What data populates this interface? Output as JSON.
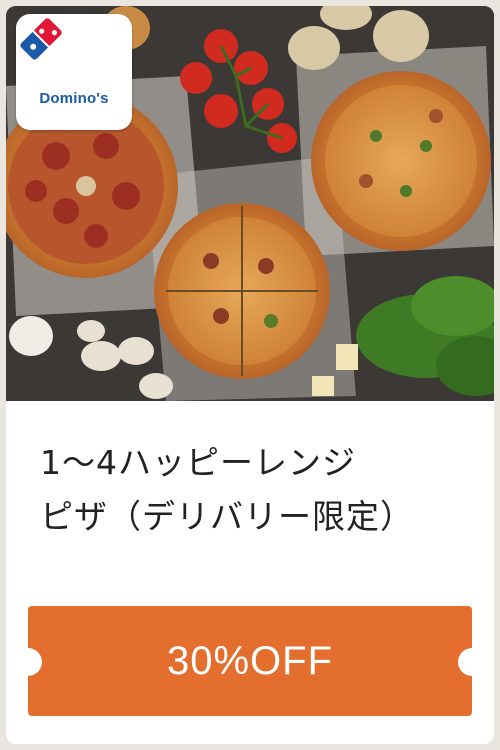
{
  "brand": {
    "logo_text": "Domino's",
    "logo_blue": "#1a5aa6",
    "logo_red": "#e31837"
  },
  "offer": {
    "title_line1": "1～4ハッピーレンジ",
    "title_line2": "ピザ（デリバリー限定）",
    "discount_label": "30%OFF",
    "accent_color": "#e36e2e"
  }
}
